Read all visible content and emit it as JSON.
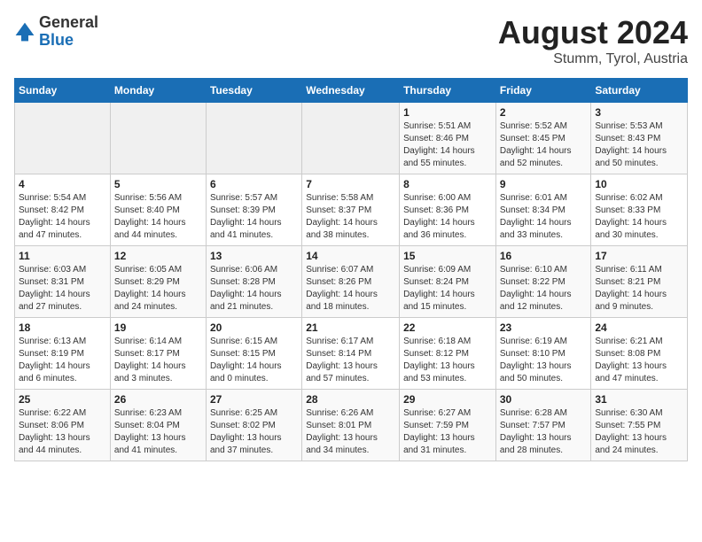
{
  "header": {
    "logo_general": "General",
    "logo_blue": "Blue",
    "title": "August 2024",
    "subtitle": "Stumm, Tyrol, Austria"
  },
  "calendar": {
    "days_of_week": [
      "Sunday",
      "Monday",
      "Tuesday",
      "Wednesday",
      "Thursday",
      "Friday",
      "Saturday"
    ],
    "weeks": [
      [
        {
          "day": "",
          "info": ""
        },
        {
          "day": "",
          "info": ""
        },
        {
          "day": "",
          "info": ""
        },
        {
          "day": "",
          "info": ""
        },
        {
          "day": "1",
          "info": "Sunrise: 5:51 AM\nSunset: 8:46 PM\nDaylight: 14 hours\nand 55 minutes."
        },
        {
          "day": "2",
          "info": "Sunrise: 5:52 AM\nSunset: 8:45 PM\nDaylight: 14 hours\nand 52 minutes."
        },
        {
          "day": "3",
          "info": "Sunrise: 5:53 AM\nSunset: 8:43 PM\nDaylight: 14 hours\nand 50 minutes."
        }
      ],
      [
        {
          "day": "4",
          "info": "Sunrise: 5:54 AM\nSunset: 8:42 PM\nDaylight: 14 hours\nand 47 minutes."
        },
        {
          "day": "5",
          "info": "Sunrise: 5:56 AM\nSunset: 8:40 PM\nDaylight: 14 hours\nand 44 minutes."
        },
        {
          "day": "6",
          "info": "Sunrise: 5:57 AM\nSunset: 8:39 PM\nDaylight: 14 hours\nand 41 minutes."
        },
        {
          "day": "7",
          "info": "Sunrise: 5:58 AM\nSunset: 8:37 PM\nDaylight: 14 hours\nand 38 minutes."
        },
        {
          "day": "8",
          "info": "Sunrise: 6:00 AM\nSunset: 8:36 PM\nDaylight: 14 hours\nand 36 minutes."
        },
        {
          "day": "9",
          "info": "Sunrise: 6:01 AM\nSunset: 8:34 PM\nDaylight: 14 hours\nand 33 minutes."
        },
        {
          "day": "10",
          "info": "Sunrise: 6:02 AM\nSunset: 8:33 PM\nDaylight: 14 hours\nand 30 minutes."
        }
      ],
      [
        {
          "day": "11",
          "info": "Sunrise: 6:03 AM\nSunset: 8:31 PM\nDaylight: 14 hours\nand 27 minutes."
        },
        {
          "day": "12",
          "info": "Sunrise: 6:05 AM\nSunset: 8:29 PM\nDaylight: 14 hours\nand 24 minutes."
        },
        {
          "day": "13",
          "info": "Sunrise: 6:06 AM\nSunset: 8:28 PM\nDaylight: 14 hours\nand 21 minutes."
        },
        {
          "day": "14",
          "info": "Sunrise: 6:07 AM\nSunset: 8:26 PM\nDaylight: 14 hours\nand 18 minutes."
        },
        {
          "day": "15",
          "info": "Sunrise: 6:09 AM\nSunset: 8:24 PM\nDaylight: 14 hours\nand 15 minutes."
        },
        {
          "day": "16",
          "info": "Sunrise: 6:10 AM\nSunset: 8:22 PM\nDaylight: 14 hours\nand 12 minutes."
        },
        {
          "day": "17",
          "info": "Sunrise: 6:11 AM\nSunset: 8:21 PM\nDaylight: 14 hours\nand 9 minutes."
        }
      ],
      [
        {
          "day": "18",
          "info": "Sunrise: 6:13 AM\nSunset: 8:19 PM\nDaylight: 14 hours\nand 6 minutes."
        },
        {
          "day": "19",
          "info": "Sunrise: 6:14 AM\nSunset: 8:17 PM\nDaylight: 14 hours\nand 3 minutes."
        },
        {
          "day": "20",
          "info": "Sunrise: 6:15 AM\nSunset: 8:15 PM\nDaylight: 14 hours and 0 minutes."
        },
        {
          "day": "21",
          "info": "Sunrise: 6:17 AM\nSunset: 8:14 PM\nDaylight: 13 hours\nand 57 minutes."
        },
        {
          "day": "22",
          "info": "Sunrise: 6:18 AM\nSunset: 8:12 PM\nDaylight: 13 hours\nand 53 minutes."
        },
        {
          "day": "23",
          "info": "Sunrise: 6:19 AM\nSunset: 8:10 PM\nDaylight: 13 hours\nand 50 minutes."
        },
        {
          "day": "24",
          "info": "Sunrise: 6:21 AM\nSunset: 8:08 PM\nDaylight: 13 hours\nand 47 minutes."
        }
      ],
      [
        {
          "day": "25",
          "info": "Sunrise: 6:22 AM\nSunset: 8:06 PM\nDaylight: 13 hours\nand 44 minutes."
        },
        {
          "day": "26",
          "info": "Sunrise: 6:23 AM\nSunset: 8:04 PM\nDaylight: 13 hours\nand 41 minutes."
        },
        {
          "day": "27",
          "info": "Sunrise: 6:25 AM\nSunset: 8:02 PM\nDaylight: 13 hours\nand 37 minutes."
        },
        {
          "day": "28",
          "info": "Sunrise: 6:26 AM\nSunset: 8:01 PM\nDaylight: 13 hours\nand 34 minutes."
        },
        {
          "day": "29",
          "info": "Sunrise: 6:27 AM\nSunset: 7:59 PM\nDaylight: 13 hours\nand 31 minutes."
        },
        {
          "day": "30",
          "info": "Sunrise: 6:28 AM\nSunset: 7:57 PM\nDaylight: 13 hours\nand 28 minutes."
        },
        {
          "day": "31",
          "info": "Sunrise: 6:30 AM\nSunset: 7:55 PM\nDaylight: 13 hours\nand 24 minutes."
        }
      ]
    ]
  }
}
